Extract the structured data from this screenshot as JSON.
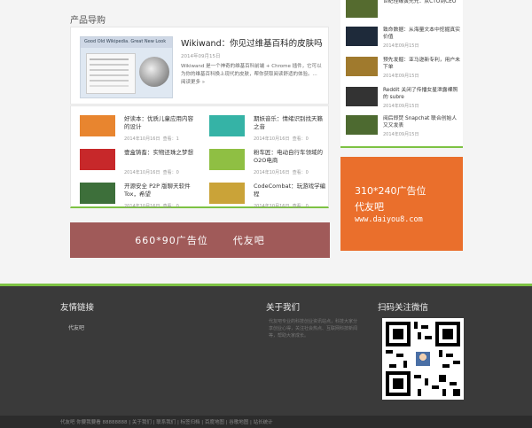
{
  "section": {
    "title": "产品导购"
  },
  "featured": {
    "title": "Wikiwand：你见过维基百科的皮肤吗",
    "date": "2014年09月15日",
    "views": "查看：2",
    "description": "Wikiwand 是一个神奇的维基百科前端 + Chrome 插件，它可以为你的维基百科换上现代的皮肤，帮你获取阅读舒适的体验。",
    "read_more": "... 阅读更多 »",
    "thumb_text": "Good Old Wikipedia. Great New Look"
  },
  "grid": [
    {
      "title": "好读本：优质儿童应用内容的设计",
      "date": "2014年10月16日",
      "views": "查看：1",
      "color": "#e8852f"
    },
    {
      "title": "期妖音乐：情绪识别找天籁之音",
      "date": "2014年10月16日",
      "views": "查看：0",
      "color": "#35b3a6"
    },
    {
      "title": "壹盒铸畜：实物还珠之梦想",
      "date": "2014年10月16日",
      "views": "查看：0",
      "color": "#c7282a"
    },
    {
      "title": "粉车匠：电动自行车领域的O2O电商",
      "date": "2014年10月16日",
      "views": "查看：0",
      "color": "#8fbf43"
    },
    {
      "title": "开源安全 P2P 版聊天软件 Tox，希望",
      "date": "2014年10月16日",
      "views": "查看：0",
      "color": "#3d6f3a"
    },
    {
      "title": "CodeCombat：玩游戏学编程",
      "date": "2014年10月16日",
      "views": "查看：0",
      "color": "#caa338"
    }
  ],
  "sidebar": [
    {
      "title": "世纪佳缘黄先元：从CTO到CEO",
      "date": "",
      "color": "#556b2f"
    },
    {
      "title": "致命数据：从海量文本中挖掘真实价值",
      "date": "2014年09月15日",
      "color": "#1e2a3a"
    },
    {
      "title": "预先发掘：亚马逊新专利，用户未下单",
      "date": "2014年09月15日",
      "color": "#a07a2d"
    },
    {
      "title": "Reddit 关闭了传播女星泄露裸照的 subre",
      "date": "2014年09月15日",
      "color": "#333"
    },
    {
      "title": "阅后即焚 Snapchat 联合创始人又又发表",
      "date": "2014年09月15日",
      "color": "#4d6a30"
    }
  ],
  "ads": {
    "banner_660": {
      "size": "660*90广告位",
      "brand": "代友吧",
      "color": "#a05a59"
    },
    "banner_310": {
      "size": "310*240广告位",
      "brand": "代友吧",
      "url": "www.daiyou8.com",
      "color": "#ea6f2c"
    }
  },
  "footer": {
    "links_title": "友情链接",
    "link_1": "代友吧",
    "about_title": "关于我们",
    "about_text": "代友吧专业的科技创业资讯站点，科技大家分享创业心得，关注社会热点、互联网科技新闻等，帮助大家成长。",
    "wechat_title": "扫码关注微信",
    "copyright": "代友吧 你要我要看 88888888 | 关于我们 | 联系我们 | 标签归档 | 百度地图 | 谷歌地图 | 站长统计"
  }
}
